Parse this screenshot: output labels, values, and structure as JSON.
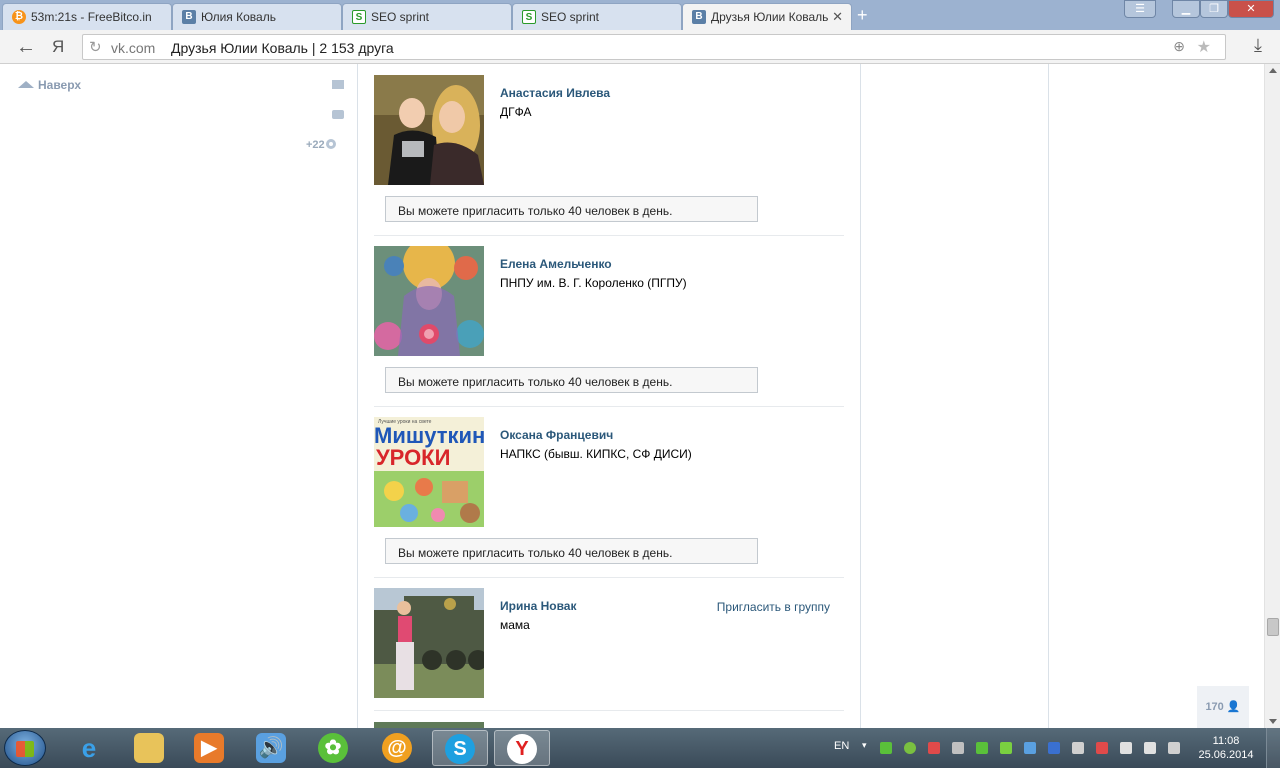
{
  "browser": {
    "tabs": [
      {
        "label": "53m:21s - FreeBitco.in",
        "favicon": "bitcoin-icon",
        "active": false
      },
      {
        "label": "Юлия Коваль",
        "favicon": "vk-icon",
        "active": false
      },
      {
        "label": "SEO sprint",
        "favicon": "seo-sprint-icon",
        "active": false
      },
      {
        "label": "SEO sprint",
        "favicon": "seo-sprint-icon",
        "active": false
      },
      {
        "label": "Друзья Юлии Коваль",
        "favicon": "vk-icon",
        "active": true
      }
    ],
    "address": {
      "ya_label": "Я",
      "domain": "vk.com",
      "title": "Друзья Юлии Коваль | 2 153 друга"
    }
  },
  "sidebar": {
    "back_to_top": "Наверх",
    "notifications_count": "+22"
  },
  "friends": [
    {
      "name": "Анастасия Ивлева",
      "info": "ДГФА",
      "invite_note": "Вы можете пригласить только 40 человек в день."
    },
    {
      "name": "Елена Амельченко",
      "info": "ПНПУ им. В. Г. Короленко (ПГПУ)",
      "invite_note": "Вы можете пригласить только 40 человек в день."
    },
    {
      "name": "Оксана Францевич",
      "info": "НАПКС (бывш. КИПКС, СФ ДИСИ)",
      "invite_note": "Вы можете пригласить только 40 человек в день."
    },
    {
      "name": "Ирина Новак",
      "info": "мама",
      "invite_link": "Пригласить в группу"
    }
  ],
  "photo_texts": {
    "book_top": "Лучшие уроки на свете",
    "book_word1": "Мишуткин",
    "book_word2": "УРОКИ"
  },
  "online_counter": "170",
  "taskbar": {
    "apps": [
      "internet-explorer-icon",
      "file-explorer-icon",
      "media-player-icon",
      "volume-app-icon",
      "icq-icon",
      "mail-agent-icon",
      "skype-icon",
      "yandex-browser-icon"
    ],
    "language": "EN",
    "time": "11:08",
    "date": "25.06.2014"
  },
  "colors": {
    "link": "#2b587a",
    "muted": "#8a9bb1"
  }
}
